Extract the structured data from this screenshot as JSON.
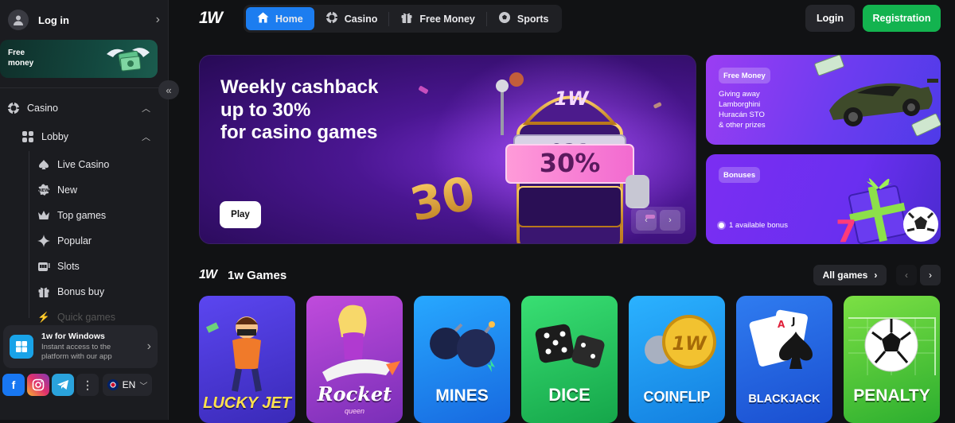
{
  "sidebar": {
    "login_label": "Log in",
    "free_money": {
      "line1": "Free",
      "line2": "money"
    },
    "nav": {
      "casino": "Casino",
      "lobby": "Lobby",
      "items": [
        {
          "label": "Live Casino",
          "icon": "spade-icon"
        },
        {
          "label": "New",
          "icon": "new-badge-icon"
        },
        {
          "label": "Top games",
          "icon": "crown-icon"
        },
        {
          "label": "Popular",
          "icon": "sparkle-icon"
        },
        {
          "label": "Slots",
          "icon": "slot-machine-icon"
        },
        {
          "label": "Bonus buy",
          "icon": "gift-icon"
        },
        {
          "label": "Quick games",
          "icon": "bolt-icon"
        }
      ]
    },
    "app_card": {
      "title": "1w for Windows",
      "subtitle_line1": "Instant access to the",
      "subtitle_line2": "platform with our app"
    },
    "social": {
      "facebook": "f",
      "more": "⋮"
    },
    "language": "EN"
  },
  "header": {
    "logo": "1W",
    "tabs": [
      {
        "label": "Home",
        "icon": "home-icon",
        "active": true
      },
      {
        "label": "Casino",
        "icon": "casino-chip-icon",
        "active": false
      },
      {
        "label": "Free Money",
        "icon": "gift-icon",
        "active": false
      },
      {
        "label": "Sports",
        "icon": "soccer-ball-icon",
        "active": false
      }
    ],
    "login_label": "Login",
    "registration_label": "Registration"
  },
  "hero": {
    "title_line1": "Weekly cashback",
    "title_line2": "up to 30%",
    "title_line3": "for casino games",
    "play_label": "Play",
    "art_text_30": "30",
    "art_text_percent": "30%",
    "art_logo": "1W"
  },
  "promos": [
    {
      "pill": "Free Money",
      "line1": "Giving away",
      "line2": "Lamborghini",
      "line3": "Huracán STO",
      "line4": "& other prizes"
    },
    {
      "pill": "Bonuses",
      "bonus_line": "1 available bonus"
    }
  ],
  "games_section": {
    "logo": "1W",
    "title": "1w Games",
    "all_games_label": "All games",
    "games": [
      {
        "name": "LUCKY JET",
        "color": "#4b3cd8"
      },
      {
        "name": "Rocket",
        "subname": "queen",
        "color": "#a63bd0"
      },
      {
        "name": "MINES",
        "color": "#1f8ff0"
      },
      {
        "name": "DICE",
        "color": "#2dcc6a"
      },
      {
        "name": "COINFLIP",
        "color": "#1fa0f0"
      },
      {
        "name": "BLACKJACK",
        "color": "#1e6ae8"
      },
      {
        "name": "PENALTY",
        "color": "#4cd137"
      }
    ]
  }
}
